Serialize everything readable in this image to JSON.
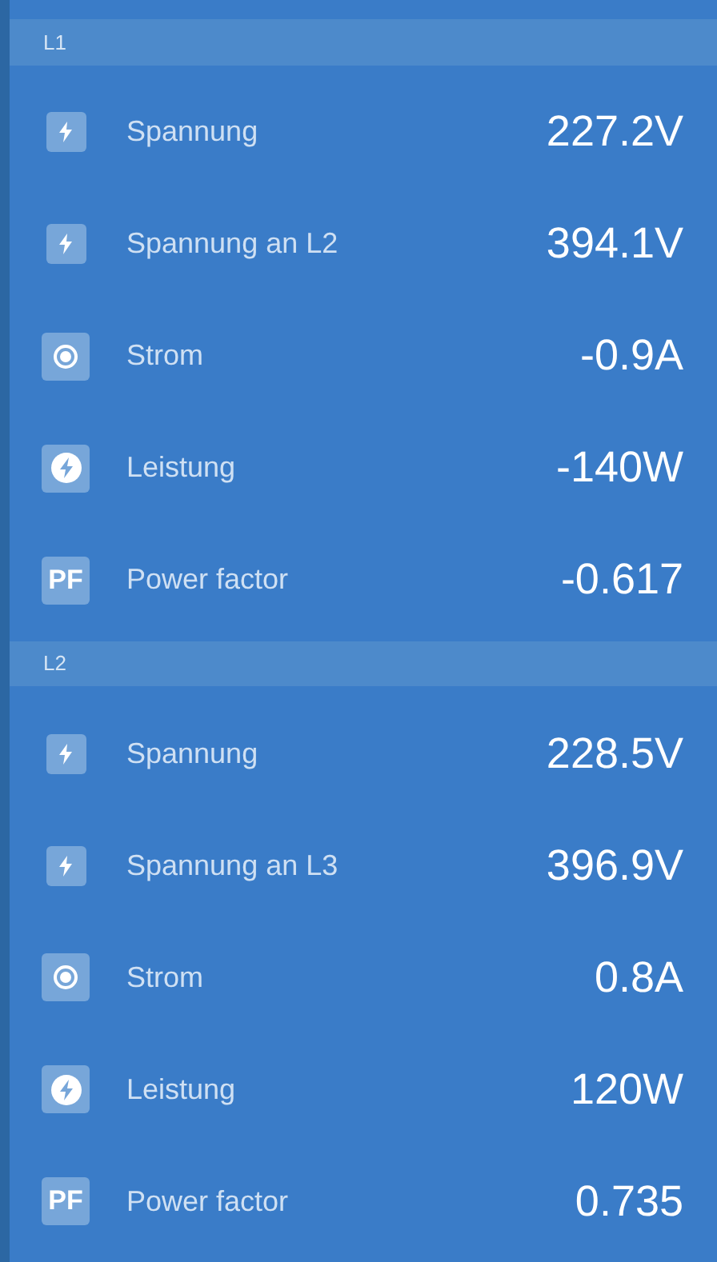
{
  "sections": [
    {
      "title": "L1",
      "rows": [
        {
          "kind": "voltage",
          "label": "Spannung",
          "value": "227.2V"
        },
        {
          "kind": "voltage",
          "label": "Spannung an L2",
          "value": "394.1V"
        },
        {
          "kind": "current",
          "label": "Strom",
          "value": "-0.9A"
        },
        {
          "kind": "power",
          "label": "Leistung",
          "value": "-140W"
        },
        {
          "kind": "factor",
          "icon_text": "PF",
          "label": "Power factor",
          "value": "-0.617"
        }
      ]
    },
    {
      "title": "L2",
      "rows": [
        {
          "kind": "voltage",
          "label": "Spannung",
          "value": "228.5V"
        },
        {
          "kind": "voltage",
          "label": "Spannung an L3",
          "value": "396.9V"
        },
        {
          "kind": "current",
          "label": "Strom",
          "value": "0.8A"
        },
        {
          "kind": "power",
          "label": "Leistung",
          "value": "120W"
        },
        {
          "kind": "factor",
          "icon_text": "PF",
          "label": "Power factor",
          "value": "0.735"
        }
      ]
    }
  ]
}
